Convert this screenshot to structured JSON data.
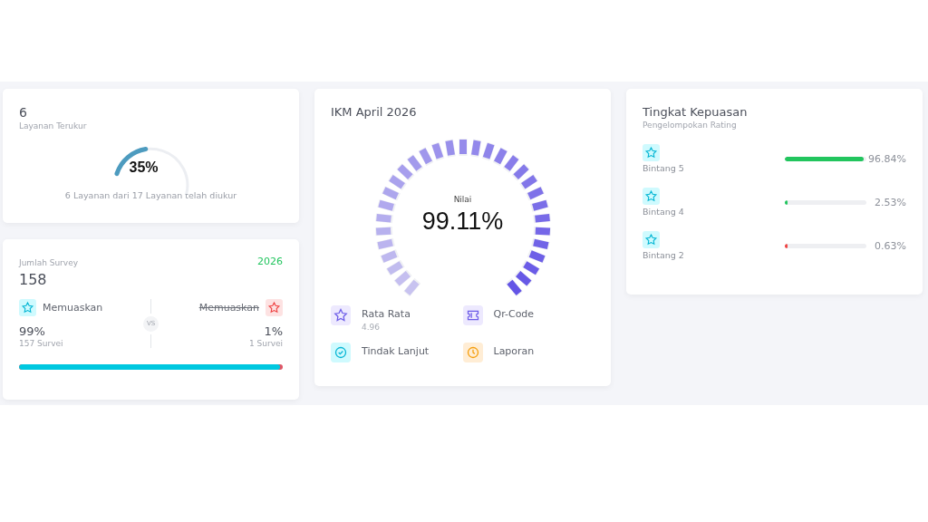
{
  "services": {
    "count": "6",
    "label": "Layanan Terukur",
    "percent": "35%",
    "note": "6 Layanan dari 17 Layanan telah diukur"
  },
  "survey": {
    "label": "Jumlah Survey",
    "year": "2026",
    "total": "158",
    "vs": "VS",
    "positive": {
      "label": "Memuaskan",
      "percent": "99%",
      "count": "157 Survei"
    },
    "negative": {
      "label": "Memuaskan",
      "percent": "1%",
      "count": "1 Survei"
    },
    "level": 0.99
  },
  "ikm": {
    "title": "IKM April 2026",
    "gauge_label": "Nilai",
    "value": "99.11%",
    "items": [
      {
        "kind": "star",
        "label": "Rata Rata",
        "sub": "4.96"
      },
      {
        "kind": "ticket",
        "label": "Qr-Code"
      },
      {
        "kind": "check",
        "label": "Tindak Lanjut"
      },
      {
        "kind": "clock",
        "label": "Laporan"
      }
    ]
  },
  "satisfaction": {
    "title": "Tingkat Kepuasan",
    "subtitle": "Pengelompokan Rating",
    "rows": [
      {
        "label": "Bintang 5",
        "level": 0.9684,
        "value": "96.84%",
        "color": "#22c55e"
      },
      {
        "label": "Bintang 4",
        "level": 0.0253,
        "value": "2.53%",
        "color": "#22c55e"
      },
      {
        "label": "Bintang 2",
        "level": 0.0063,
        "value": "0.63%",
        "color": "#ef4444"
      }
    ]
  }
}
